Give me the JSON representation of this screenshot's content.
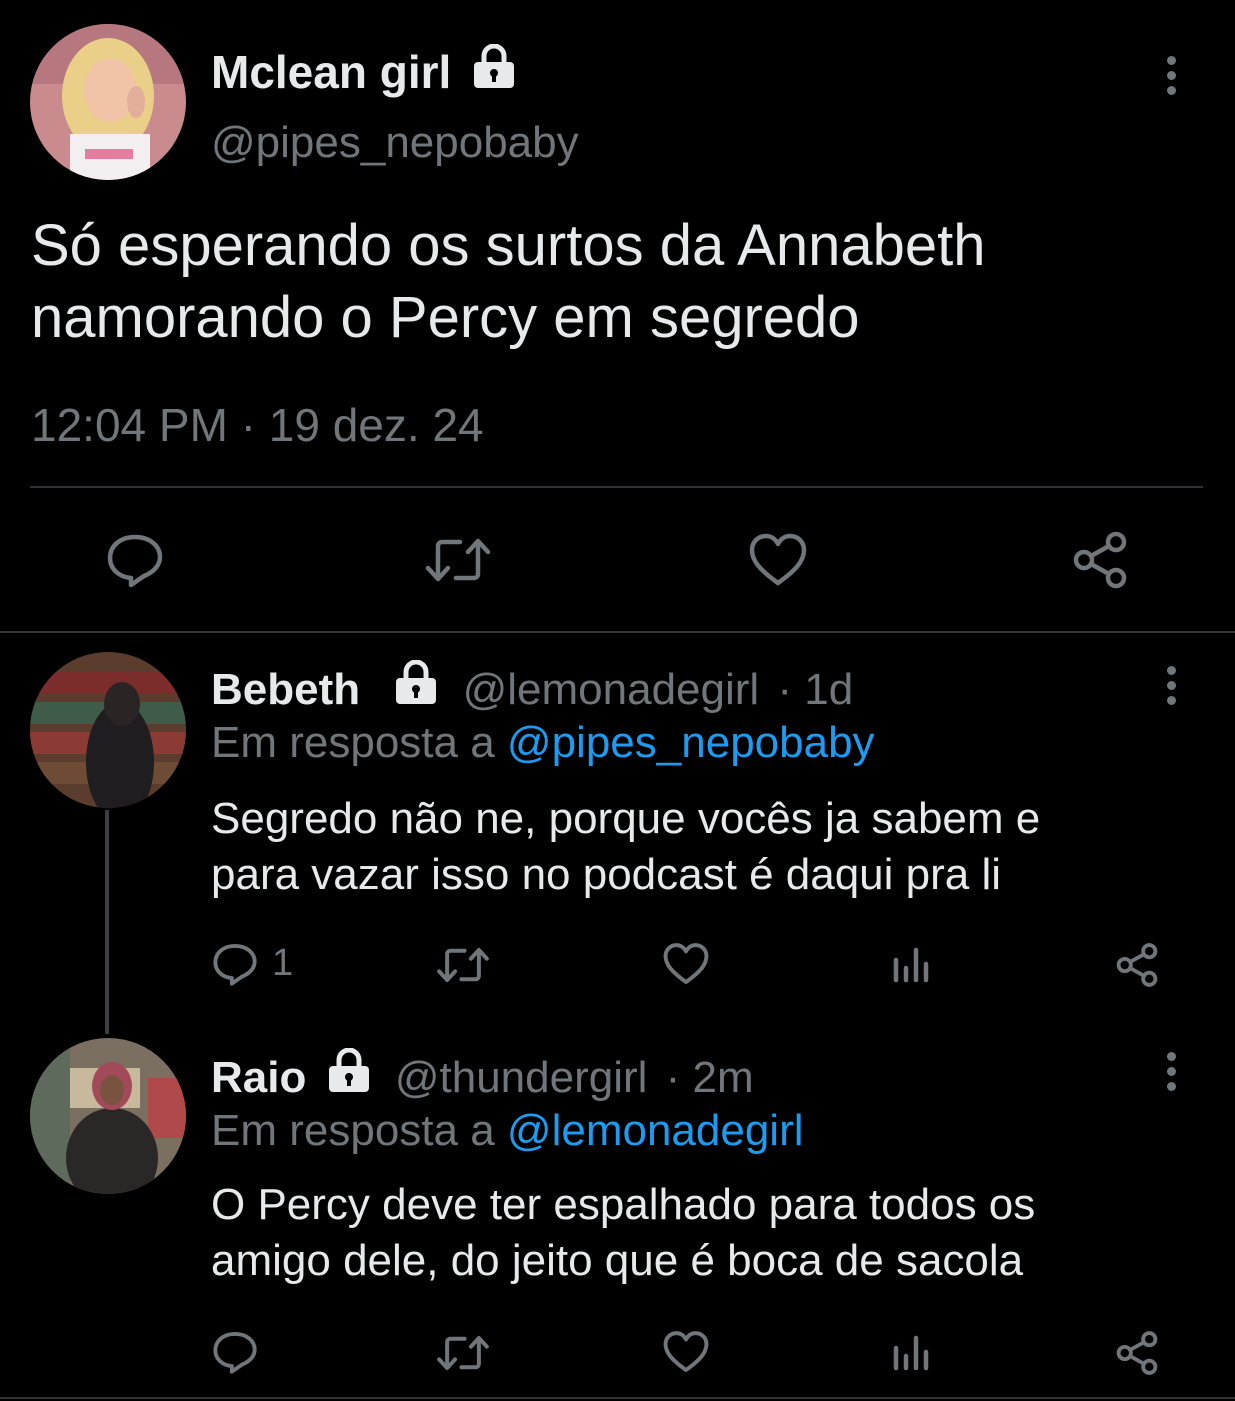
{
  "main_tweet": {
    "author_name": "Mclean girl",
    "handle": "@pipes_nepobaby",
    "text_line1": "Só esperando os surtos da Annabeth",
    "text_line2": "namorando o Percy em segredo",
    "timestamp": "12:04 PM · 19 dez. 24"
  },
  "replies": [
    {
      "author_name": "Bebeth",
      "handle": "@lemonadegirl",
      "time": "· 1d",
      "reply_prefix": "Em resposta a",
      "reply_to": "@pipes_nepobaby",
      "text_line1": "Segredo não ne, porque vocês ja sabem e",
      "text_line2": "para vazar isso no podcast é daqui pra li",
      "reply_count": "1"
    },
    {
      "author_name": "Raio",
      "handle": "@thundergirl",
      "time": "· 2m",
      "reply_prefix": "Em resposta a",
      "reply_to": "@lemonadegirl",
      "text_line1": "O Percy deve ter espalhado para todos os",
      "text_line2": "amigo dele, do jeito que é boca de sacola",
      "reply_count": ""
    }
  ],
  "colors": {
    "background": "#000000",
    "text": "#e7e9ea",
    "secondary": "#71767b",
    "link": "#1d9bf0",
    "divider": "#2f3336"
  },
  "icons": [
    "lock-icon",
    "more-icon",
    "reply-icon",
    "retweet-icon",
    "like-icon",
    "share-icon",
    "analytics-icon"
  ]
}
